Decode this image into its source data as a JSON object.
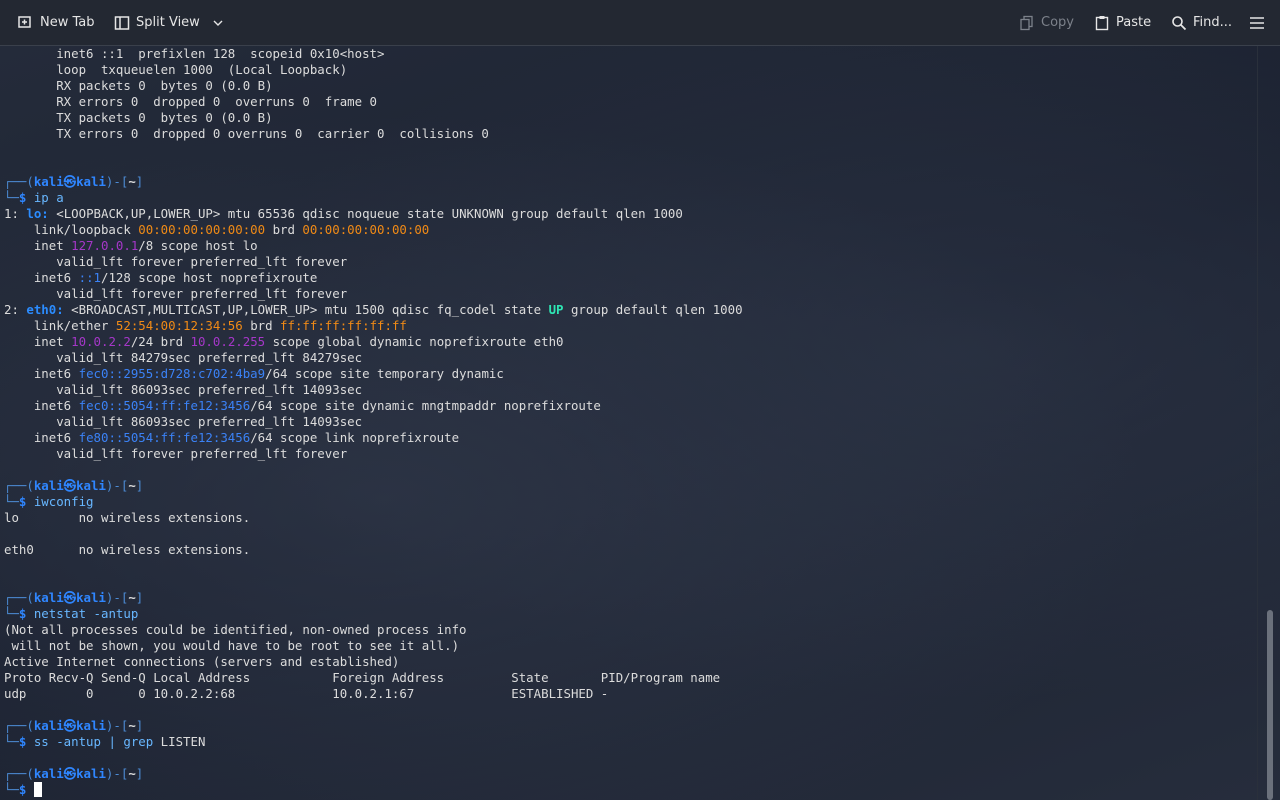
{
  "toolbar": {
    "new_tab": "New Tab",
    "split_view": "Split View",
    "copy": "Copy",
    "paste": "Paste",
    "find": "Find..."
  },
  "prompt": {
    "user": "kali",
    "host": "kali",
    "dir": "~"
  },
  "lines": [
    [
      {
        "t": "       inet6 ::1  prefixlen 128  scopeid 0x10<host>"
      }
    ],
    [
      {
        "t": "       loop  txqueuelen 1000  (Local Loopback)"
      }
    ],
    [
      {
        "t": "       RX packets 0  bytes 0 (0.0 B)"
      }
    ],
    [
      {
        "t": "       RX errors 0  dropped 0  overruns 0  frame 0"
      }
    ],
    [
      {
        "t": "       TX packets 0  bytes 0 (0.0 B)"
      }
    ],
    [
      {
        "t": "       TX errors 0  dropped 0 overruns 0  carrier 0  collisions 0"
      }
    ],
    [
      {
        "t": ""
      }
    ],
    [
      {
        "t": ""
      }
    ],
    [
      {
        "t": "┌──(",
        "c": "frame"
      },
      {
        "t": "kali㉿kali",
        "c": "kali"
      },
      {
        "t": ")-[",
        "c": "frame"
      },
      {
        "t": "~",
        "c": "bold"
      },
      {
        "t": "]",
        "c": "frame"
      }
    ],
    [
      {
        "t": "└─",
        "c": "frame"
      },
      {
        "t": "$ ",
        "c": "kali"
      },
      {
        "t": "ip a",
        "c": "cmd"
      }
    ],
    [
      {
        "t": "1: "
      },
      {
        "t": "lo: ",
        "c": "blue"
      },
      {
        "t": "<LOOPBACK,UP,LOWER_UP> mtu 65536 qdisc noqueue state UNKNOWN group default qlen 1000"
      }
    ],
    [
      {
        "t": "    link/loopback "
      },
      {
        "t": "00:00:00:00:00:00",
        "c": "orange"
      },
      {
        "t": " brd "
      },
      {
        "t": "00:00:00:00:00:00",
        "c": "orange"
      }
    ],
    [
      {
        "t": "    inet "
      },
      {
        "t": "127.0.0.1",
        "c": "purple"
      },
      {
        "t": "/8 scope host lo"
      }
    ],
    [
      {
        "t": "       valid_lft forever preferred_lft forever"
      }
    ],
    [
      {
        "t": "    inet6 "
      },
      {
        "t": "::1",
        "c": "blue-n"
      },
      {
        "t": "/128 scope host noprefixroute"
      }
    ],
    [
      {
        "t": "       valid_lft forever preferred_lft forever"
      }
    ],
    [
      {
        "t": "2: "
      },
      {
        "t": "eth0: ",
        "c": "blue"
      },
      {
        "t": "<BROADCAST,MULTICAST,UP,LOWER_UP> mtu 1500 qdisc fq_codel state "
      },
      {
        "t": "UP",
        "c": "green"
      },
      {
        "t": " group default qlen 1000"
      }
    ],
    [
      {
        "t": "    link/ether "
      },
      {
        "t": "52:54:00:12:34:56",
        "c": "orange"
      },
      {
        "t": " brd "
      },
      {
        "t": "ff:ff:ff:ff:ff:ff",
        "c": "orange"
      }
    ],
    [
      {
        "t": "    inet "
      },
      {
        "t": "10.0.2.2",
        "c": "purple"
      },
      {
        "t": "/24 brd "
      },
      {
        "t": "10.0.2.255",
        "c": "purple"
      },
      {
        "t": " scope global dynamic noprefixroute eth0"
      }
    ],
    [
      {
        "t": "       valid_lft 84279sec preferred_lft 84279sec"
      }
    ],
    [
      {
        "t": "    inet6 "
      },
      {
        "t": "fec0::2955:d728:c702:4ba9",
        "c": "blue-n"
      },
      {
        "t": "/64 scope site temporary dynamic"
      }
    ],
    [
      {
        "t": "       valid_lft 86093sec preferred_lft 14093sec"
      }
    ],
    [
      {
        "t": "    inet6 "
      },
      {
        "t": "fec0::5054:ff:fe12:3456",
        "c": "blue-n"
      },
      {
        "t": "/64 scope site dynamic mngtmpaddr noprefixroute"
      }
    ],
    [
      {
        "t": "       valid_lft 86093sec preferred_lft 14093sec"
      }
    ],
    [
      {
        "t": "    inet6 "
      },
      {
        "t": "fe80::5054:ff:fe12:3456",
        "c": "blue-n"
      },
      {
        "t": "/64 scope link noprefixroute"
      }
    ],
    [
      {
        "t": "       valid_lft forever preferred_lft forever"
      }
    ],
    [
      {
        "t": ""
      }
    ],
    [
      {
        "t": "┌──(",
        "c": "frame"
      },
      {
        "t": "kali㉿kali",
        "c": "kali"
      },
      {
        "t": ")-[",
        "c": "frame"
      },
      {
        "t": "~",
        "c": "bold"
      },
      {
        "t": "]",
        "c": "frame"
      }
    ],
    [
      {
        "t": "└─",
        "c": "frame"
      },
      {
        "t": "$ ",
        "c": "kali"
      },
      {
        "t": "iwconfig",
        "c": "cmd"
      }
    ],
    [
      {
        "t": "lo        no wireless extensions."
      }
    ],
    [
      {
        "t": ""
      }
    ],
    [
      {
        "t": "eth0      no wireless extensions."
      }
    ],
    [
      {
        "t": ""
      }
    ],
    [
      {
        "t": ""
      }
    ],
    [
      {
        "t": "┌──(",
        "c": "frame"
      },
      {
        "t": "kali㉿kali",
        "c": "kali"
      },
      {
        "t": ")-[",
        "c": "frame"
      },
      {
        "t": "~",
        "c": "bold"
      },
      {
        "t": "]",
        "c": "frame"
      }
    ],
    [
      {
        "t": "└─",
        "c": "frame"
      },
      {
        "t": "$ ",
        "c": "kali"
      },
      {
        "t": "netstat -antup",
        "c": "cmd"
      }
    ],
    [
      {
        "t": "(Not all processes could be identified, non-owned process info"
      }
    ],
    [
      {
        "t": " will not be shown, you would have to be root to see it all.)"
      }
    ],
    [
      {
        "t": "Active Internet connections (servers and established)"
      }
    ],
    [
      {
        "t": "Proto Recv-Q Send-Q Local Address           Foreign Address         State       PID/Program name"
      }
    ],
    [
      {
        "t": "udp        0      0 10.0.2.2:68             10.0.2.1:67             ESTABLISHED -"
      }
    ],
    [
      {
        "t": ""
      }
    ],
    [
      {
        "t": "┌──(",
        "c": "frame"
      },
      {
        "t": "kali㉿kali",
        "c": "kali"
      },
      {
        "t": ")-[",
        "c": "frame"
      },
      {
        "t": "~",
        "c": "bold"
      },
      {
        "t": "]",
        "c": "frame"
      }
    ],
    [
      {
        "t": "└─",
        "c": "frame"
      },
      {
        "t": "$ ",
        "c": "kali"
      },
      {
        "t": "ss -antup | ",
        "c": "cmd"
      },
      {
        "t": "grep",
        "c": "cmd"
      },
      {
        "t": " LISTEN"
      }
    ],
    [
      {
        "t": ""
      }
    ],
    [
      {
        "t": "┌──(",
        "c": "frame"
      },
      {
        "t": "kali㉿kali",
        "c": "kali"
      },
      {
        "t": ")-[",
        "c": "frame"
      },
      {
        "t": "~",
        "c": "bold"
      },
      {
        "t": "]",
        "c": "frame"
      }
    ],
    [
      {
        "t": "└─",
        "c": "frame"
      },
      {
        "t": "$ ",
        "c": "kali"
      },
      {
        "t": "",
        "c": "cursor"
      }
    ]
  ]
}
